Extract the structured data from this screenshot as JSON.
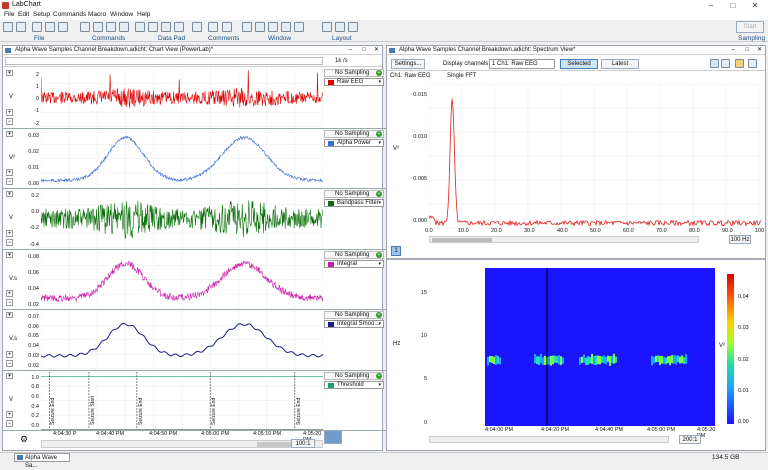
{
  "app": {
    "title": "LabChart"
  },
  "menu": [
    "File",
    "Edit",
    "Setup",
    "Commands",
    "Macro",
    "Window",
    "Help"
  ],
  "toolbar": {
    "groups": [
      "File",
      "Commands",
      "Data Pad",
      "Comments",
      "Window",
      "Layout",
      "Sampling"
    ],
    "start_label": "Start"
  },
  "chart_view": {
    "title": "Alpha Wave Samples Channel Breakdown.adicht: Chart View (PowerLab)*",
    "rate": "1k /s",
    "channels": [
      {
        "name": "Raw EEG",
        "unit": "V",
        "sampling": "No Sampling",
        "color": "#dd0000",
        "ticks": [
          "2",
          "1",
          "0",
          "-1",
          "-2"
        ]
      },
      {
        "name": "Alpha Power",
        "unit": "V²",
        "sampling": "No Sampling",
        "color": "#3b6fd8",
        "ticks": [
          "0.03",
          "0.02",
          "0.01",
          "0.00"
        ]
      },
      {
        "name": "Bandpass Filter",
        "unit": "V",
        "sampling": "No Sampling",
        "color": "#0a6e0a",
        "ticks": [
          "0.2",
          "0.0",
          "-0.2",
          "-0.4"
        ]
      },
      {
        "name": "Integral",
        "unit": "V.s",
        "sampling": "No Sampling",
        "color": "#cc1aa8",
        "ticks": [
          "0.08",
          "0.06",
          "0.04",
          "0.02"
        ]
      },
      {
        "name": "Integral Smoo...",
        "unit": "V.s",
        "sampling": "No Sampling",
        "color": "#1a1a8a",
        "ticks": [
          "0.07",
          "0.06",
          "0.05",
          "0.04",
          "0.03",
          "0.02"
        ]
      },
      {
        "name": "Threshold",
        "unit": "V",
        "sampling": "No Sampling",
        "color": "#1aa07a",
        "ticks": [
          "1.0",
          "0.8",
          "0.6",
          "0.4",
          "0.2",
          "0.0"
        ]
      }
    ],
    "comments": [
      "Seizure End",
      "Seizure Start",
      "Seizure End",
      "Seizure End",
      "Seizure End"
    ],
    "time_ticks": [
      "4:04:30 P",
      "4:04:40 PM",
      "4:04:50 PM",
      "4:05:00 PM",
      "4:05:10 PM",
      "4:05:20 PM",
      "4:05:30 PM"
    ],
    "page_markers": [
      "3",
      "4",
      "5",
      "6"
    ],
    "zoom": "100:1"
  },
  "spectrum_view": {
    "title": "Alpha Wave Samples Channel Breakdown.adicht: Spectrum View*",
    "settings_label": "Settings...",
    "display_label": "Display channels:",
    "channel_select": "1 Ch1: Raw EEG",
    "selected_btn": "Selected",
    "latest_btn": "Latest",
    "channel_tag": "Ch1: Raw EEG",
    "fft_mode": "Single FFT",
    "yunit": "V²",
    "y_ticks": [
      "0.015",
      "0.010",
      "0.005",
      "0.000"
    ],
    "x_ticks": [
      "0.0",
      "10.0",
      "20.0",
      "30.0",
      "40.0",
      "50.0",
      "60.0",
      "70.0",
      "80.0",
      "90.0",
      "100"
    ],
    "range_label": "100 Hz",
    "page_num": "1",
    "spectrogram": {
      "y_unit": "Hz",
      "y_ticks": [
        "15",
        "10",
        "5",
        "0"
      ],
      "x_ticks": [
        "4:04:00 PM",
        "4:04:20 PM",
        "4:04:40 PM",
        "4:05:00 PM",
        "4:05:20 PM"
      ],
      "color_ticks": [
        "0.04",
        "0.03",
        "0.02",
        "0.01",
        "0.00"
      ],
      "color_unit": "V²",
      "zoom": "200:1"
    }
  },
  "statusbar": {
    "task": "Alpha Wave Sa...",
    "disk": "134.5 GB"
  },
  "colors": {
    "accent": "#1a4f8a",
    "spectrogram_bg": "#1a14ff"
  }
}
